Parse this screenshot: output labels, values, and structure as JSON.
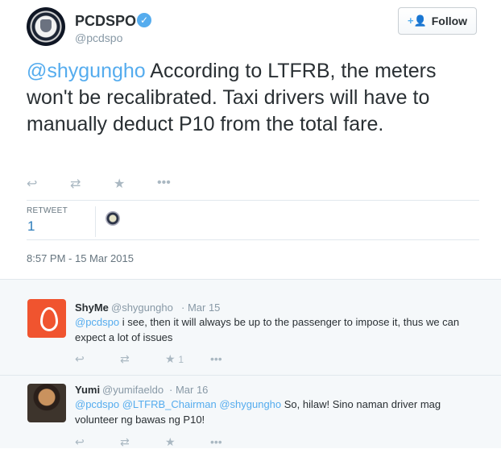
{
  "tweet": {
    "author_name": "PCDSPO",
    "author_handle": "@pcdspo",
    "verified_icon": "verified-check-icon",
    "follow_label": "Follow",
    "text_mention": "@shygungho",
    "text_body": " According to LTFRB, the meters won't be recalibrated. Taxi drivers will have to manually deduct P10 from the total fare.",
    "retweet_label": "RETWEET",
    "retweet_count": "1",
    "timestamp": "8:57 PM - 15 Mar 2015",
    "accent_color": "#55acee"
  },
  "replies": [
    {
      "name": "ShyMe",
      "handle": "@shygungho",
      "date": "· Mar 15",
      "mention": "@pcdspo",
      "text": " i see, then it will always be up to the passenger to impose it, thus we can expect a lot of issues",
      "favorite_count": "1"
    },
    {
      "name": "Yumi",
      "handle": "@yumifaeldo",
      "date": "· Mar 16",
      "mentions": "@pcdspo @LTFRB_Chairman @shygungho",
      "text": "  So, hilaw! Sino naman driver mag volunteer ng bawas ng P10!"
    }
  ]
}
